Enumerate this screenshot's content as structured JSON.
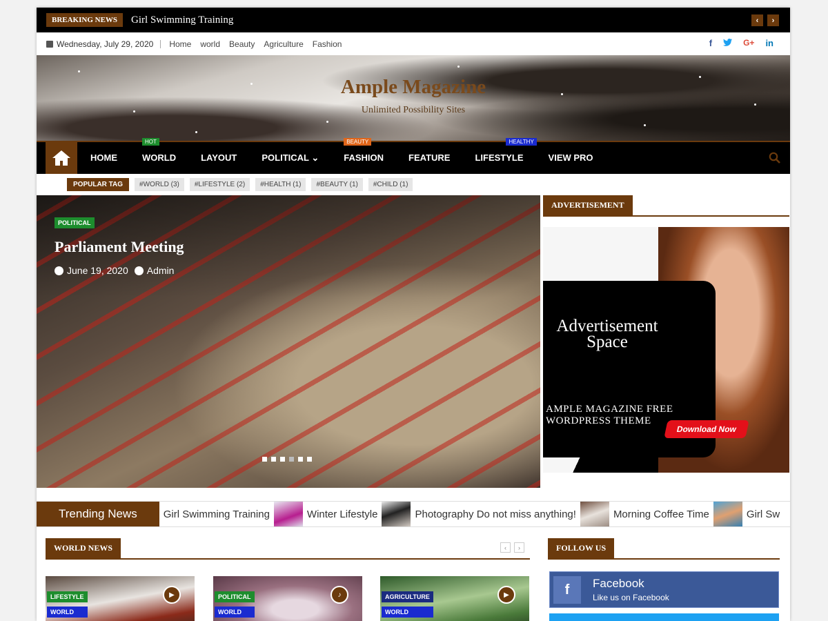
{
  "breaking": {
    "label": "BREAKING NEWS",
    "headline": "Girl Swimming Training",
    "prev_icon": "chevron-left-icon",
    "next_icon": "chevron-right-icon"
  },
  "topbar": {
    "date": "Wednesday, July 29, 2020",
    "links": [
      "Home",
      "world",
      "Beauty",
      "Agriculture",
      "Fashion"
    ],
    "social": [
      {
        "name": "f",
        "color": "#3b5998"
      },
      {
        "name": "t",
        "color": "#1da1f2"
      },
      {
        "name": "G+",
        "color": "#dd4b39"
      },
      {
        "name": "in",
        "color": "#0077b5"
      }
    ]
  },
  "header": {
    "title": "Ample Magazine",
    "tagline": "Unlimited Possibility Sites"
  },
  "nav": {
    "items": [
      {
        "label": "HOME",
        "badge": ""
      },
      {
        "label": "WORLD",
        "badge": "HOT",
        "badge_color": "#1d8d2d"
      },
      {
        "label": "LAYOUT",
        "badge": ""
      },
      {
        "label": "POLITICAL ⌄",
        "badge": ""
      },
      {
        "label": "FASHION",
        "badge": "BEAUTY",
        "badge_color": "#e0661b"
      },
      {
        "label": "FEATURE",
        "badge": ""
      },
      {
        "label": "LIFESTYLE",
        "badge": "HEALTHY",
        "badge_color": "#1a2bd0"
      },
      {
        "label": "VIEW PRO",
        "badge": ""
      }
    ]
  },
  "tags": {
    "label": "POPULAR TAG",
    "items": [
      "#WORLD (3)",
      "#LIFESTYLE (2)",
      "#HEALTH (1)",
      "#BEAUTY (1)",
      "#CHILD (1)"
    ]
  },
  "hero": {
    "category": "POLITICAL",
    "title": "Parliament Meeting",
    "date": "June 19, 2020",
    "author": "Admin"
  },
  "sidebar": {
    "ad_heading": "ADVERTISEMENT",
    "ad_title_line1": "Advertisement",
    "ad_title_line2": "Space",
    "ad_sub_line1": "AMPLE MAGAZINE FREE",
    "ad_sub_line2": "WORDPRESS THEME",
    "ad_button": "Download Now",
    "follow_heading": "FOLLOW US",
    "facebook_title": "Facebook",
    "facebook_sub": "Like us on Facebook"
  },
  "trending": {
    "label": "Trending News",
    "items": [
      "Girl Swimming Training",
      "Winter Lifestyle",
      "Photography Do not miss anything!",
      "Morning Coffee Time",
      "Girl Sw"
    ]
  },
  "world_news": {
    "heading": "WORLD NEWS",
    "cards": [
      {
        "badge1": "LIFESTYLE",
        "badge1_color": "#1d8d2d",
        "badge2": "WORLD",
        "badge2_color": "#1a2bd0",
        "media": "video-icon"
      },
      {
        "badge1": "POLITICAL",
        "badge1_color": "#1d8d2d",
        "badge2": "WORLD",
        "badge2_color": "#1a2bd0",
        "media": "audio-icon"
      },
      {
        "badge1": "AGRICULTURE",
        "badge1_color": "#1a2b80",
        "badge2": "WORLD",
        "badge2_color": "#1a2bd0",
        "media": "video-icon"
      }
    ]
  },
  "colors": {
    "accent": "#6b3a0d"
  }
}
